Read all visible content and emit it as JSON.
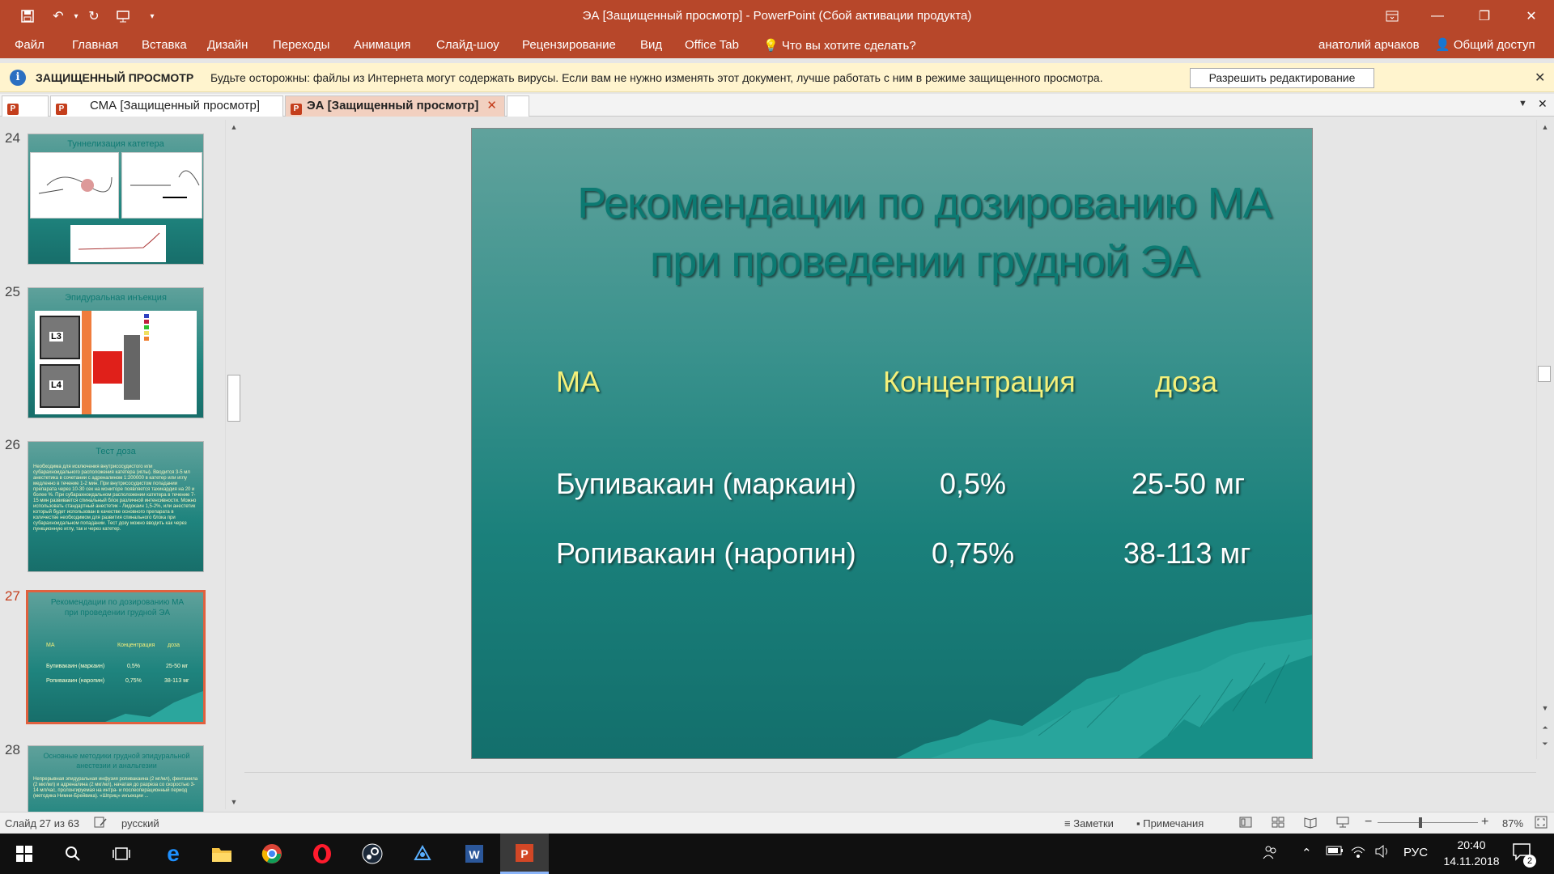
{
  "window": {
    "title": "ЭА [Защищенный просмотр] - PowerPoint (Сбой активации продукта)",
    "colors": {
      "brand": "#b7472a",
      "slide_title": "#0c7a72",
      "slide_header": "#f4f07a"
    }
  },
  "ribbon": {
    "tabs": [
      "Файл",
      "Главная",
      "Вставка",
      "Дизайн",
      "Переходы",
      "Анимация",
      "Слайд-шоу",
      "Рецензирование",
      "Вид",
      "Office Tab"
    ],
    "tell_me": "Что вы хотите сделать?",
    "user": "анатолий арчаков",
    "share": "Общий доступ"
  },
  "protected_view": {
    "title": "ЗАЩИЩЕННЫЙ ПРОСМОТР",
    "message": "Будьте осторожны: файлы из Интернета могут содержать вирусы. Если вам не нужно изменять этот документ, лучше работать с ним в режиме защищенного просмотра.",
    "button": "Разрешить редактирование"
  },
  "doc_tabs": [
    {
      "label": "СМА [Защищенный просмотр]",
      "active": false
    },
    {
      "label": "ЭА [Защищенный просмотр]",
      "active": true
    }
  ],
  "thumbnails": [
    {
      "num": "24",
      "title": "Туннелизация катетера"
    },
    {
      "num": "25",
      "title": "Эпидуральная инъекция",
      "labels": [
        "L3",
        "L4"
      ]
    },
    {
      "num": "26",
      "title": "Тест доза",
      "text": "Необходима для исключения внутрисосудистого или субарахноидального расположения катетера (иглы). Вводится 3-5 мл анестетика в сочетании с адреналином 1:200000 в катетер или иглу медленно в течение 1-2 мин. При внутрисосудистом попадании препарата через 10-30 сек на мониторе появляется тахикардия на 20 и более %. При субарахноидальном расположении катетера в течение 7-15 мин развивается спинальный блок различной интенсивности. Можно использовать стандартный анестетик - Лидокаин 1,5-2%, или анестетик который будет использован в качестве основного препарата в количестве необходимом для развития спинального блока при субарахноидальном попадании. Тест дозу можно вводить как через пункционную иглу, так и через катетер."
    },
    {
      "num": "27",
      "title": "Рекомендации по дозированию МА при проведении грудной ЭА",
      "active": true,
      "rows": [
        [
          "МА",
          "Концентрация",
          "доза"
        ],
        [
          "Бупивакаин (маркаин)",
          "0,5%",
          "25-50 мг"
        ],
        [
          "Ропивакаин (наропин)",
          "0,75%",
          "38-113 мг"
        ]
      ]
    },
    {
      "num": "28",
      "title": "Основные методики грудной эпидуральной анестезии и анальгезии",
      "text": "Непрерывная эпидуральная инфузия ропивакаина (2 мг/мл), фентанила (2 мкг/мл) и адреналина (2 мкг/мл), начатая до разреза со скоростью 3-14 мл/час, пролонгируемая на интра- и послеоперационный период (методика Нимни-Брейвика). «Шприц» инъекции ..."
    }
  ],
  "slide": {
    "title_line1": "Рекомендации по дозированию МА",
    "title_line2": "при проведении грудной ЭА",
    "headers": [
      "МА",
      "Концентрация",
      "доза"
    ],
    "rows": [
      [
        "Бупивакаин (маркаин)",
        "0,5%",
        "25-50 мг"
      ],
      [
        "Ропивакаин (наропин)",
        "0,75%",
        "38-113 мг"
      ]
    ]
  },
  "status": {
    "slide_info": "Слайд 27 из 63",
    "language": "русский",
    "notes": "Заметки",
    "comments": "Примечания",
    "zoom": "87%",
    "zoom_value": 0.87
  },
  "taskbar": {
    "lang": "РУС",
    "time": "20:40",
    "date": "14.11.2018",
    "notif_count": "2"
  }
}
